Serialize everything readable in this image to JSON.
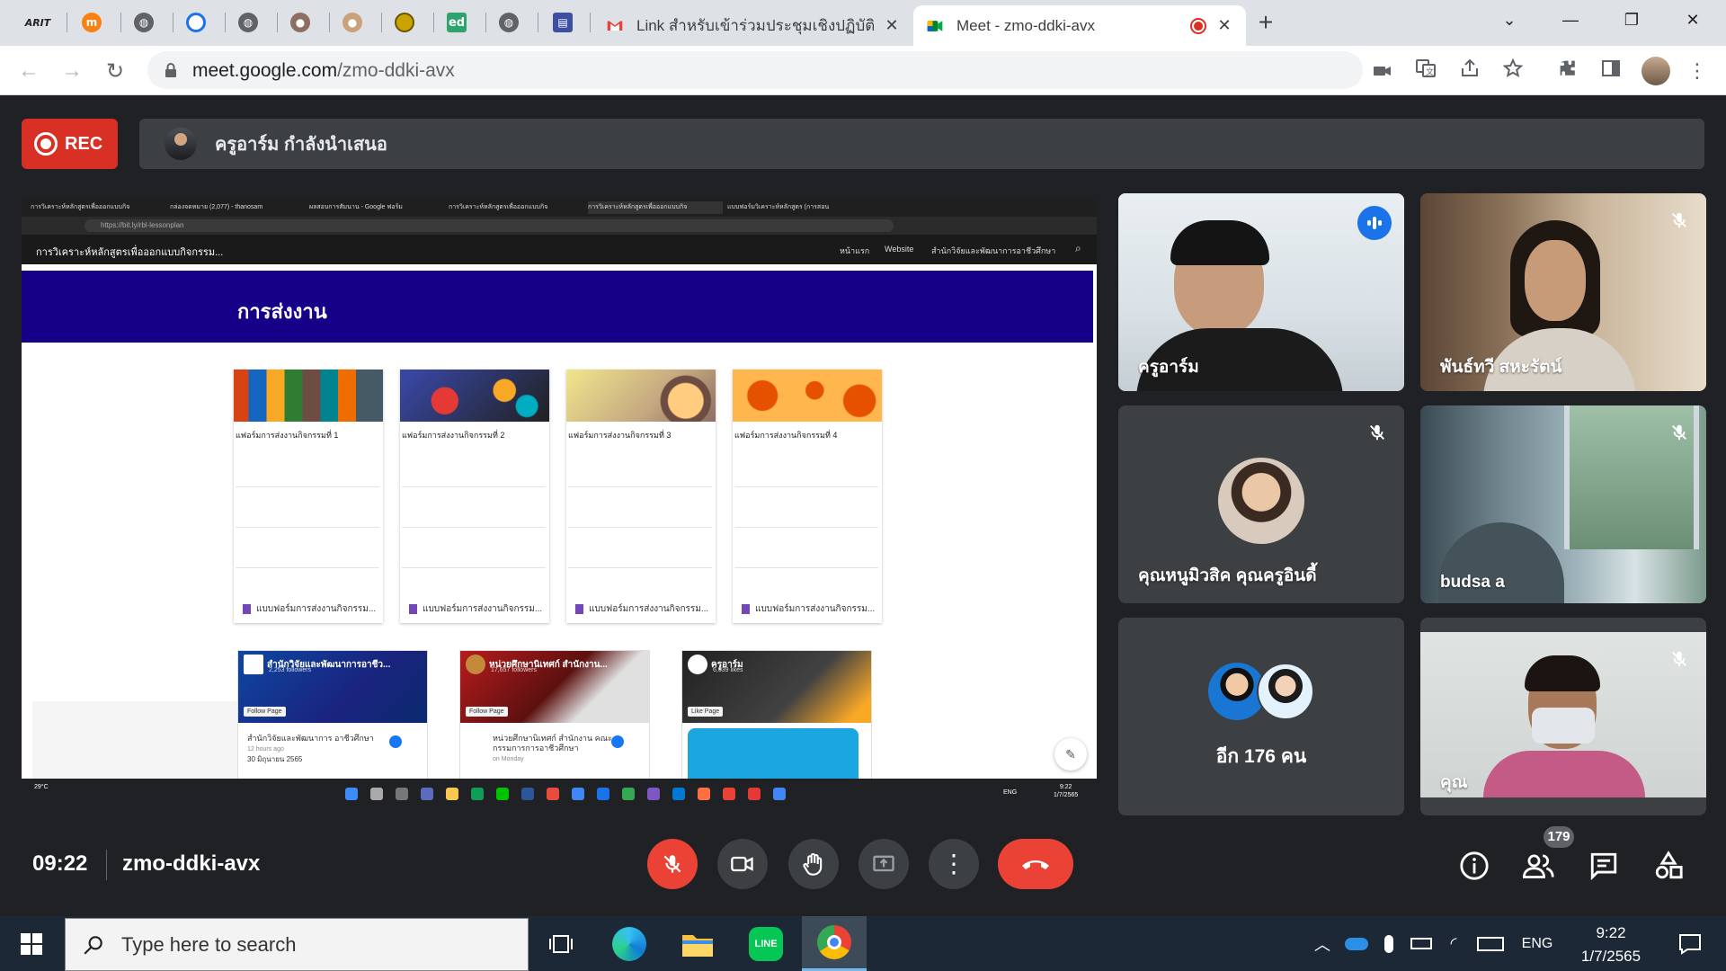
{
  "browser": {
    "tabs": [
      {
        "label": "Link สำหรับเข้าร่วมประชุมเชิงปฏิบัติการ",
        "closable": true
      },
      {
        "label": "Meet - zmo-ddki-avx",
        "closable": true,
        "active": true
      }
    ],
    "address": {
      "host": "meet.google.com",
      "path": "/zmo-ddki-avx"
    }
  },
  "meet": {
    "rec_label": "REC",
    "presenter_text": "ครูอาร์ม กำลังนำเสนอ",
    "meeting_code": "zmo-ddki-avx",
    "time": "09:22",
    "participant_count": "179",
    "participants": [
      {
        "name": "ครูอาร์ม",
        "speaking": true
      },
      {
        "name": "พันธ์ทวี สหะรัตน์",
        "muted": true
      },
      {
        "name": "คุณหนูมิวสิค คุณครูอินดี้",
        "muted": true
      },
      {
        "name": "budsa a",
        "muted": true
      },
      {
        "name": "อีก 176 คน"
      },
      {
        "name": "คุณ",
        "muted": true
      }
    ]
  },
  "shared_screen": {
    "mini_tabs": [
      "การวิเคราะห์หลักสูตรเพื่อออกแบบกิจ",
      "กล่องจดหมาย (2,077) - thanosam",
      "ผลสอบการสัมนาน - Google ฟอร์ม",
      "การวิเคราะห์หลักสูตรเพื่อออกแบบกิจ",
      "การวิเคราะห์หลักสูตรเพื่อออกแบบกิจ",
      "แบบฟอร์มวิเคราะห์หลักสูตร (การสอน"
    ],
    "url": "https://bit.ly/rbl-lessonplan",
    "site_title": "การวิเคราะห์หลักสูตรเพื่อออกแบบกิจกรรม...",
    "site_nav": [
      "หน้าแรก",
      "Website",
      "สำนักวิจัยและพัฒนาการอาชีวศึกษา"
    ],
    "banner_title": "การส่งงาน",
    "forms": [
      {
        "title": "แฟอร์มการส่งงานกิจกรรมที่ 1",
        "footer": "แบบฟอร์มการส่งงานกิจกรรม..."
      },
      {
        "title": "แฟอร์มการส่งงานกิจกรรมที่ 2",
        "footer": "แบบฟอร์มการส่งงานกิจกรรม..."
      },
      {
        "title": "แฟอร์มการส่งงานกิจกรรมที่ 3",
        "footer": "แบบฟอร์มการส่งงานกิจกรรม..."
      },
      {
        "title": "แฟอร์มการส่งงานกิจกรรมที่ 4",
        "footer": "แบบฟอร์มการส่งงานกิจกรรม..."
      }
    ],
    "fb_pages": [
      {
        "name": "สำนักวิจัยและพัฒนาการอาชีว...",
        "followers": "2,253 followers",
        "button": "Follow Page",
        "post": "สำนักวิจัยและพัฒนาการ อาชีวศึกษา",
        "post_time": "12 hours ago",
        "post_date": "30 มิถุนายน 2565"
      },
      {
        "name": "หน่วยศึกษานิเทศก์ สำนักงาน...",
        "followers": "17,657 followers",
        "button": "Follow Page",
        "post": "หน่วยศึกษานิเทศก์ สำนักงาน คณะกรรมการการอาชีวศึกษา",
        "post_time": "on Monday"
      },
      {
        "name": "ครูอาร์ม",
        "followers": "6,639 likes",
        "button": "Like Page"
      }
    ],
    "taskbar_temp": "29°C",
    "taskbar_time": "9:22",
    "taskbar_date": "1/7/2565"
  },
  "windows": {
    "search_placeholder": "Type here to search",
    "lang": "ENG",
    "time": "9:22",
    "date": "1/7/2565"
  }
}
